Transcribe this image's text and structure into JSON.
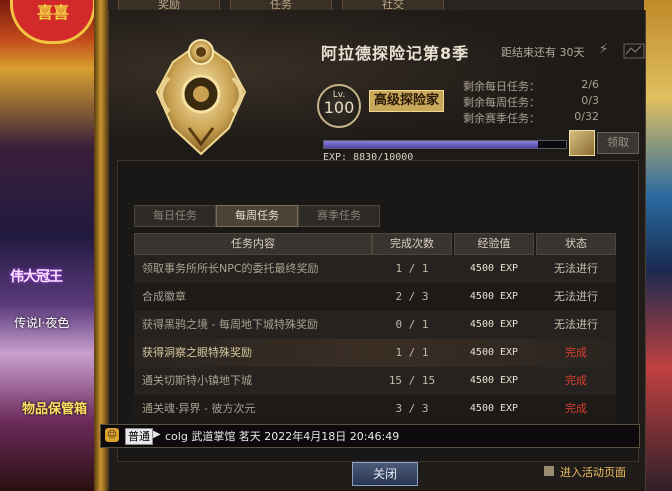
{
  "top_tabs": [
    "奖励",
    "任务",
    "社交"
  ],
  "left_side": {
    "badge": "喜喜",
    "hero_name": "伟大冠王",
    "legend_tag": "传说Ⅰ·夜色",
    "safe_label": "物品保管箱"
  },
  "season": {
    "title": "阿拉德探险记第8季",
    "countdown": "距结束还有 30天",
    "level_label": "Lv.",
    "level": "100",
    "rank_title": "高级探险家",
    "stats": [
      {
        "label": "剩余每日任务：",
        "value": "2/6"
      },
      {
        "label": "剩余每周任务：",
        "value": "0/3"
      },
      {
        "label": "剩余赛季任务：",
        "value": "0/32"
      }
    ],
    "exp_label": "EXP:",
    "exp_value": "8830/10000",
    "exp_progress": 0.883,
    "claim_label": "领取"
  },
  "sub_tabs": [
    {
      "label": "每日任务",
      "active": false
    },
    {
      "label": "每周任务",
      "active": true
    },
    {
      "label": "赛季任务",
      "active": false
    }
  ],
  "table": {
    "headers": [
      "任务内容",
      "完成次数",
      "经验值",
      "状态"
    ],
    "rows": [
      {
        "name": "领取事务所所长NPC的委托最终奖励",
        "count": "1 / 1",
        "exp": "4500 EXP",
        "status": "无法进行",
        "done": false
      },
      {
        "name": "合成徽章",
        "count": "2 / 3",
        "exp": "4500 EXP",
        "status": "无法进行",
        "done": false
      },
      {
        "name": "获得黑鸦之境 - 每周地下城特殊奖励",
        "count": "0 / 1",
        "exp": "4500 EXP",
        "status": "无法进行",
        "done": false
      },
      {
        "name": "获得洞察之眼特殊奖励",
        "count": "1 / 1",
        "exp": "4500 EXP",
        "status": "完成",
        "done": true
      },
      {
        "name": "通关切斯特小镇地下城",
        "count": "15 / 15",
        "exp": "4500 EXP",
        "status": "完成",
        "done": true
      },
      {
        "name": "通关魂·异界 - 彼方次元",
        "count": "3 / 3",
        "exp": "4500 EXP",
        "status": "完成",
        "done": true
      }
    ]
  },
  "chat": {
    "channel": "普通",
    "text": "colg  武道掌馆  茗天  2022年4月18日 20:46:49"
  },
  "footer": {
    "close_label": "关闭",
    "enter_label": "进入活动页面"
  },
  "colors": {
    "done_status": "#d84030",
    "exp_bar": "#6a60c0",
    "rank_badge": "#c9a85a"
  }
}
